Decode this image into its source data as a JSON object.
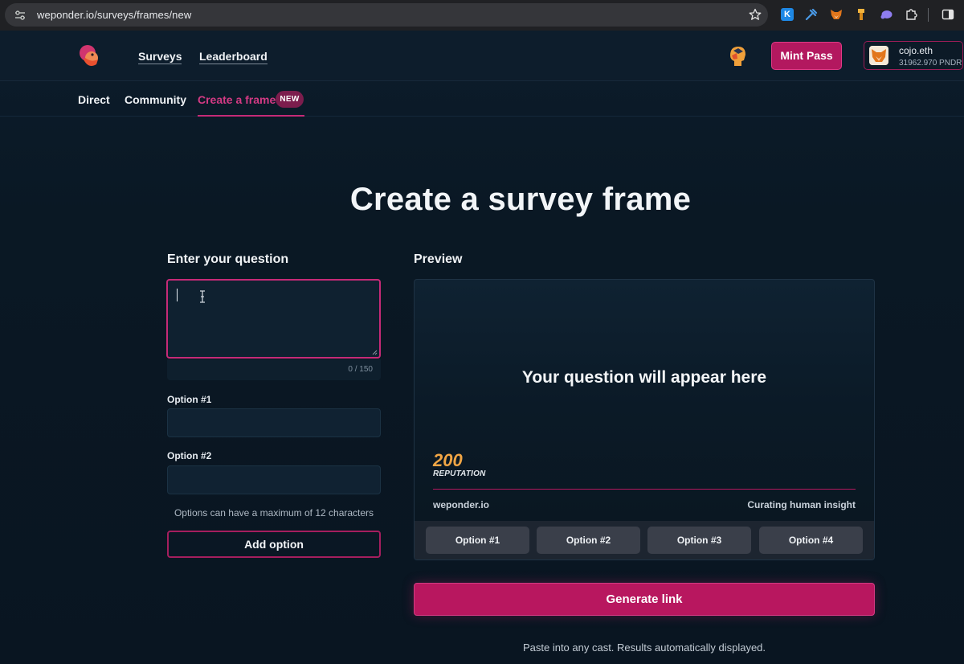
{
  "browser": {
    "url": "weponder.io/surveys/frames/new",
    "extensions": [
      "k-extension-icon",
      "metamask-icon",
      "bookmark-extension-icon",
      "puzzle-icon"
    ]
  },
  "nav": {
    "surveys": "Surveys",
    "leaderboard": "Leaderboard",
    "mint_pass": "Mint Pass",
    "wallet_name": "cojo.eth",
    "wallet_balance": "31962.970 PNDR"
  },
  "subnav": {
    "direct": "Direct",
    "community": "Community",
    "create_frame": "Create a frame",
    "new_badge": "NEW"
  },
  "main": {
    "title": "Create a survey frame",
    "question_label": "Enter your question",
    "question_value": "",
    "counter": "0 / 150",
    "option1_label": "Option #1",
    "option1_value": "",
    "option2_label": "Option #2",
    "option2_value": "",
    "options_note": "Options can have a maximum of 12 characters",
    "add_option": "Add option"
  },
  "preview": {
    "label": "Preview",
    "question": "Your question will appear here",
    "reputation_value": "200",
    "reputation_label": "REPUTATION",
    "site": "weponder.io",
    "tagline": "Curating human insight",
    "options": [
      "Option #1",
      "Option #2",
      "Option #3",
      "Option #4"
    ]
  },
  "actions": {
    "generate": "Generate link",
    "paste_note": "Paste into any cast. Results automatically displayed."
  },
  "colors": {
    "accent": "#b8175f",
    "accent_text": "#d43a84",
    "reputation": "#f0a545",
    "background": "#0b1722"
  }
}
